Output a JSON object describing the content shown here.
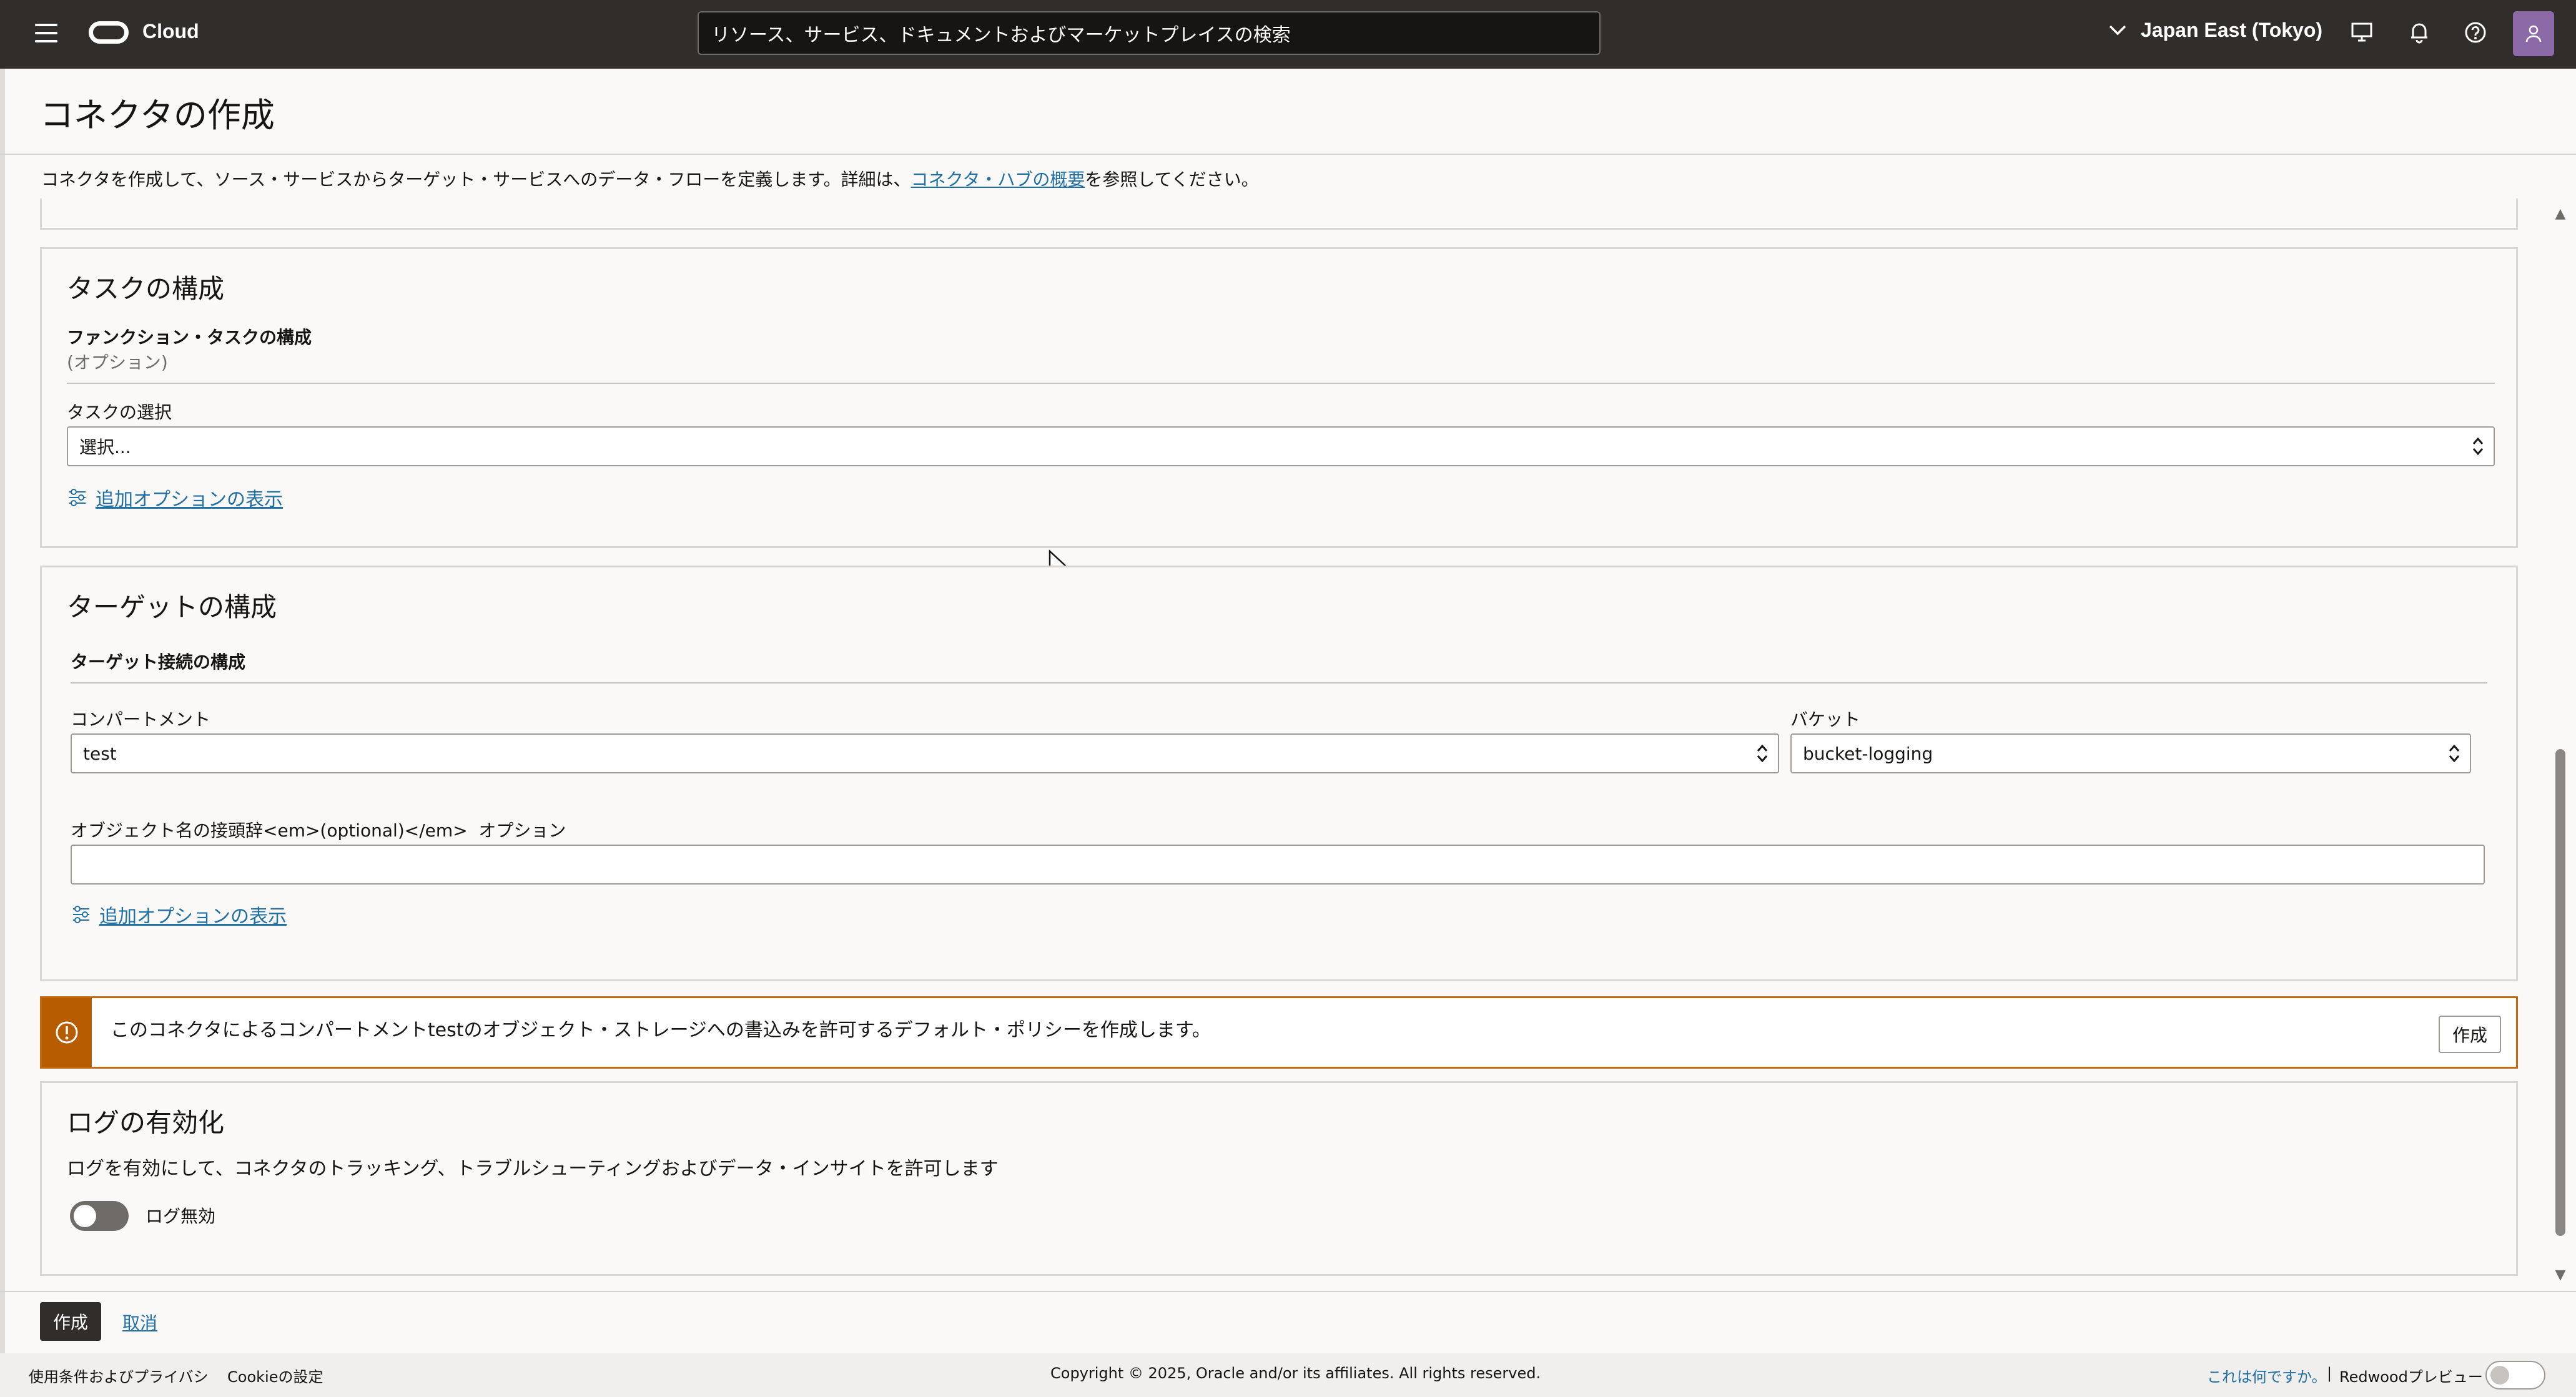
{
  "topbar": {
    "brand": "Cloud",
    "search_placeholder": "リソース、サービス、ドキュメントおよびマーケットプレイスの検索",
    "region": "Japan East (Tokyo)",
    "icons": [
      "menu-icon",
      "oracle-logo",
      "chevron-down-icon",
      "monitor-icon",
      "bell-icon",
      "help-icon",
      "user-icon"
    ]
  },
  "page": {
    "title": "コネクタの作成",
    "intro_prefix": "コネクタを作成して、ソース・サービスからターゲット・サービスへのデータ・フローを定義します。詳細は、",
    "intro_link": "コネクタ・ハブの概要",
    "intro_suffix": "を参照してください。"
  },
  "task": {
    "heading": "タスクの構成",
    "section_title": "ファンクション・タスクの構成",
    "section_sub": "(オプション)",
    "select_label": "タスクの選択",
    "select_value": "選択...",
    "more_options": "追加オプションの表示"
  },
  "target": {
    "heading": "ターゲットの構成",
    "section_title": "ターゲット接続の構成",
    "compartment_label": "コンパートメント",
    "compartment_value": "test",
    "bucket_label": "バケット",
    "bucket_value": "bucket-logging",
    "prefix_label": "オブジェクト名の接頭辞<em>(optional)</em>",
    "prefix_option": "オプション",
    "prefix_value": "",
    "more_options": "追加オプションの表示"
  },
  "warning": {
    "message": "このコネクタによるコンパートメントtestのオブジェクト・ストレージへの書込みを許可するデフォルト・ポリシーを作成します。",
    "button": "作成",
    "color": "#b75c00"
  },
  "logs": {
    "heading": "ログの有効化",
    "description": "ログを有効にして、コネクタのトラッキング、トラブルシューティングおよびデータ・インサイトを許可します",
    "toggle_label": "ログ無効"
  },
  "actions": {
    "create": "作成",
    "cancel": "取消"
  },
  "footer": {
    "terms": "使用条件およびプライバシ",
    "cookies": "Cookieの設定",
    "copyright": "Copyright © 2025, Oracle and/or its affiliates. All rights reserved.",
    "what_is_this": "これは何ですか。",
    "separator": "|",
    "redwood": "Redwoodプレビュー"
  }
}
